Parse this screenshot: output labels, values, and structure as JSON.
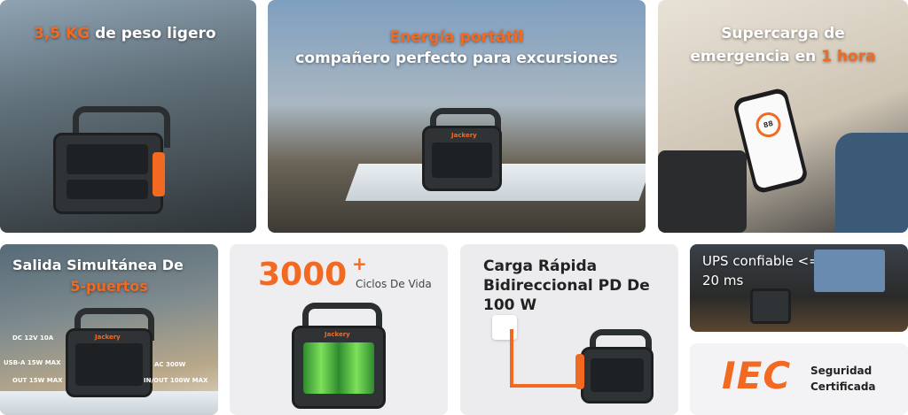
{
  "tiles": {
    "weight": {
      "value": "3,5 KG",
      "text": " de peso ligero"
    },
    "portable": {
      "line1": "Energía portátil",
      "line2": "compañero perfecto para excursiones"
    },
    "charge": {
      "line1": "Supercarga de",
      "line2_prefix": "emergencia en ",
      "line2_highlight": "1 hora"
    },
    "outputs": {
      "line1": "Salida Simultánea De",
      "line2": "5-puertos",
      "ports": {
        "dc": "DC 12V 10A",
        "usba": "USB-A 15W MAX",
        "ac": "AC 300W",
        "out": "OUT 15W MAX",
        "inout": "IN/OUT 100W MAX"
      }
    },
    "cycles": {
      "number": "3000",
      "plus": "+",
      "label": "Ciclos De Vida"
    },
    "fast_charge": {
      "line1": "Carga Rápida",
      "line2": "Bidireccional PD De",
      "line3": "100 W"
    },
    "ups": {
      "line1": "UPS confiable <=",
      "line2": "20 ms"
    },
    "iec": {
      "logo": "IEC",
      "line1": "Seguridad",
      "line2": "Certificada"
    }
  },
  "brand": {
    "name": "Jackery"
  },
  "phone": {
    "reading": "88"
  },
  "colors": {
    "accent": "#f26a21",
    "dark": "#2f3336"
  }
}
